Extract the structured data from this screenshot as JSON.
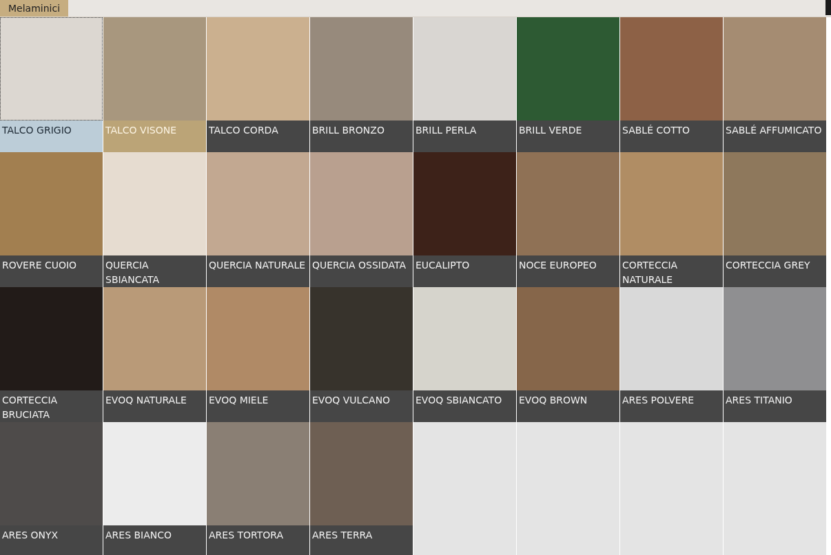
{
  "tab": {
    "label": "Melaminici",
    "selected": true
  },
  "swatches": [
    {
      "name": "TALCO GRIGIO",
      "color": "#dcd7d1",
      "selected": true,
      "hovered": false
    },
    {
      "name": "TALCO VISONE",
      "color": "#a8977e",
      "selected": false,
      "hovered": true
    },
    {
      "name": "TALCO CORDA",
      "color": "#cbb08f",
      "selected": false,
      "hovered": false
    },
    {
      "name": "BRILL BRONZO",
      "color": "#978a7c",
      "selected": false,
      "hovered": false
    },
    {
      "name": "BRILL PERLA",
      "color": "#d9d6d2",
      "selected": false,
      "hovered": false
    },
    {
      "name": "BRILL VERDE",
      "color": "#2d5a33",
      "selected": false,
      "hovered": false
    },
    {
      "name": "SABLÉ COTTO",
      "color": "#8d6146",
      "selected": false,
      "hovered": false
    },
    {
      "name": "SABLÉ AFFUMICATO",
      "color": "#a58c72",
      "selected": false,
      "hovered": false
    },
    {
      "name": "ROVERE CUOIO",
      "color": "#a27f50",
      "selected": false,
      "hovered": false
    },
    {
      "name": "QUERCIA SBIANCATA",
      "color": "#e6dcd0",
      "selected": false,
      "hovered": false
    },
    {
      "name": "QUERCIA NATURALE",
      "color": "#c2a891",
      "selected": false,
      "hovered": false
    },
    {
      "name": "QUERCIA OSSIDATA",
      "color": "#b9a08f",
      "selected": false,
      "hovered": false
    },
    {
      "name": "EUCALIPTO",
      "color": "#3d2219",
      "selected": false,
      "hovered": false
    },
    {
      "name": "NOCE EUROPEO",
      "color": "#8f7155",
      "selected": false,
      "hovered": false
    },
    {
      "name": "CORTECCIA NATURALE",
      "color": "#b08d64",
      "selected": false,
      "hovered": false
    },
    {
      "name": "CORTECCIA GREY",
      "color": "#8e785c",
      "selected": false,
      "hovered": false
    },
    {
      "name": "CORTECCIA BRUCIATA",
      "color": "#221b18",
      "selected": false,
      "hovered": false
    },
    {
      "name": "EVOQ NATURALE",
      "color": "#b99a78",
      "selected": false,
      "hovered": false
    },
    {
      "name": "EVOQ MIELE",
      "color": "#b08a66",
      "selected": false,
      "hovered": false
    },
    {
      "name": "EVOQ VULCANO",
      "color": "#37332c",
      "selected": false,
      "hovered": false
    },
    {
      "name": "EVOQ SBIANCATO",
      "color": "#d6d4cc",
      "selected": false,
      "hovered": false
    },
    {
      "name": "EVOQ BROWN",
      "color": "#86664a",
      "selected": false,
      "hovered": false
    },
    {
      "name": "ARES POLVERE",
      "color": "#d9d9d9",
      "selected": false,
      "hovered": false
    },
    {
      "name": "ARES TITANIO",
      "color": "#8f8f91",
      "selected": false,
      "hovered": false
    },
    {
      "name": "ARES ONYX",
      "color": "#4e4b4a",
      "selected": false,
      "hovered": false
    },
    {
      "name": "ARES BIANCO",
      "color": "#ececec",
      "selected": false,
      "hovered": false
    },
    {
      "name": "ARES TORTORA",
      "color": "#8a7f74",
      "selected": false,
      "hovered": false
    },
    {
      "name": "ARES TERRA",
      "color": "#6e5f53",
      "selected": false,
      "hovered": false
    }
  ]
}
